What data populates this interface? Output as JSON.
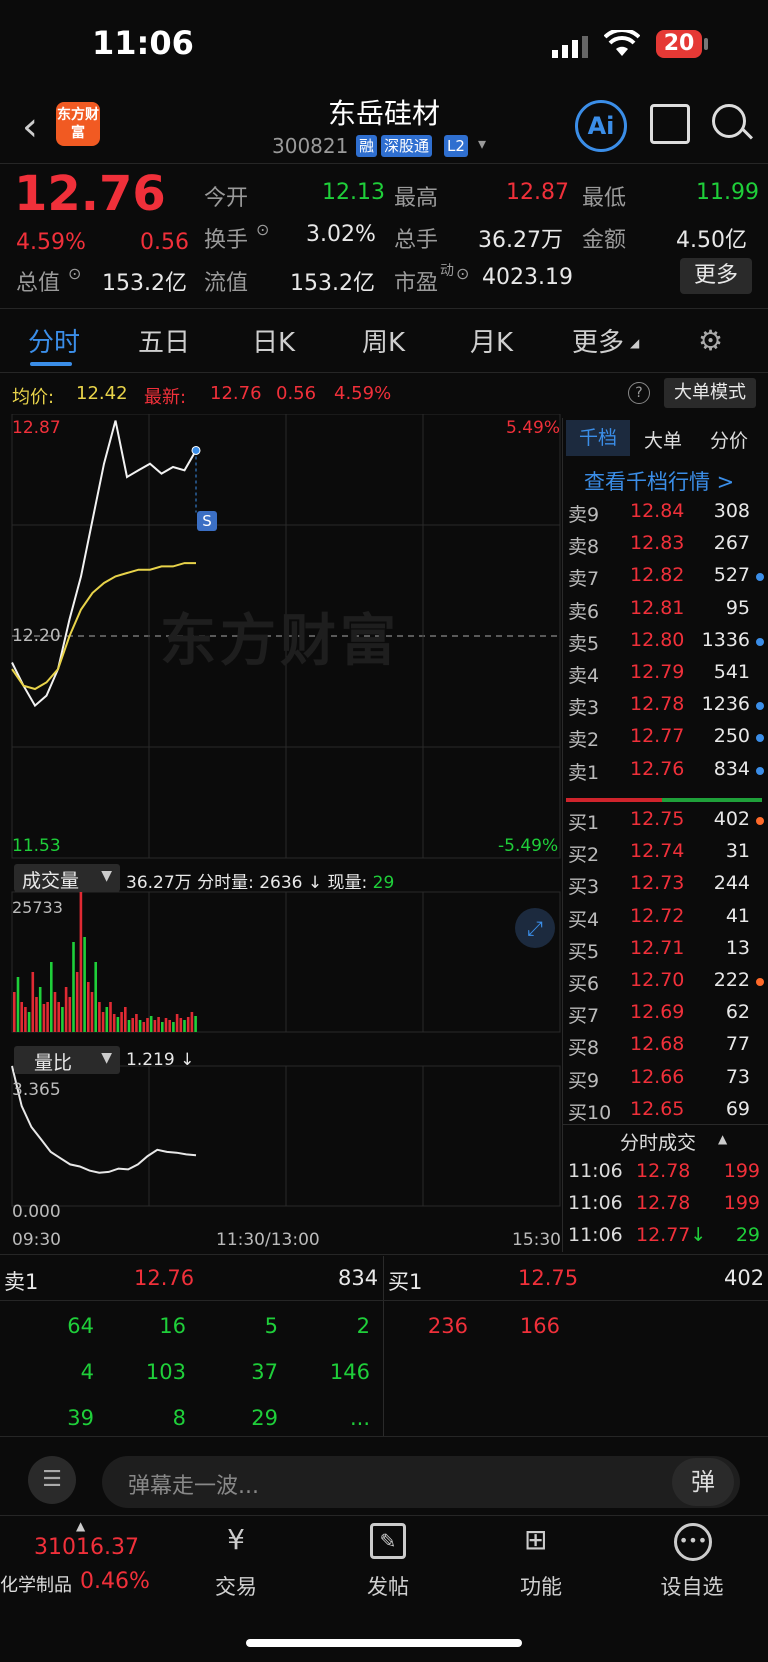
{
  "status": {
    "time": "11:06",
    "battery": "20"
  },
  "header": {
    "stock_name": "东岳硅材",
    "stock_code": "300821",
    "tags": [
      "融",
      "深股通",
      "L2"
    ],
    "logo_text": "东方财富",
    "ai_label": "Ai"
  },
  "quote": {
    "price": "12.76",
    "change_pct": "4.59%",
    "change": "0.56",
    "open_label": "今开",
    "open": "12.13",
    "high_label": "最高",
    "high": "12.87",
    "low_label": "最低",
    "low": "11.99",
    "turnover_label": "换手",
    "turnover": "3.02%",
    "volume_label": "总手",
    "volume": "36.27万",
    "amount_label": "金额",
    "amount": "4.50亿",
    "mktcap_label": "总值",
    "mktcap": "153.2亿",
    "float_label": "流值",
    "float": "153.2亿",
    "pe_label": "市盈",
    "pe_sup": "动",
    "pe": "4023.19",
    "more_label": "更多"
  },
  "tabs": [
    "分时",
    "五日",
    "日K",
    "周K",
    "月K",
    "更多"
  ],
  "info_bar": {
    "avg_label": "均价:",
    "avg": "12.42",
    "latest_label": "最新:",
    "latest": "12.76",
    "change": "0.56",
    "pct": "4.59%",
    "mode_btn": "大单模式"
  },
  "chart": {
    "top_price": "12.87",
    "mid_price": "12.20",
    "bottom_price": "11.53",
    "top_pct": "5.49%",
    "bottom_pct": "-5.49%",
    "watermark": "东方财富",
    "marker": "S",
    "vol_dropdown": "成交量",
    "vol_summary": "36.27万 分时量: 2636 ↓ 现量: ",
    "vol_now": "29",
    "vol_max": "25733",
    "ratio_dropdown": "量比",
    "ratio_value": "1.219 ↓",
    "ratio_max": "3.365",
    "ratio_min": "0.000",
    "time_start": "09:30",
    "time_mid": "11:30/13:00",
    "time_end": "15:30"
  },
  "chart_data": {
    "type": "line",
    "title": "",
    "x": [
      "09:30",
      "11:30/13:00",
      "15:30"
    ],
    "ylim": [
      11.53,
      12.87
    ],
    "series": [
      {
        "name": "最新",
        "values": [
          12.12,
          12.05,
          11.99,
          12.02,
          12.1,
          12.25,
          12.38,
          12.55,
          12.72,
          12.85,
          12.68,
          12.7,
          12.72,
          12.69,
          12.71,
          12.7,
          12.76
        ]
      },
      {
        "name": "均价",
        "values": [
          12.1,
          12.05,
          12.04,
          12.06,
          12.1,
          12.2,
          12.28,
          12.33,
          12.36,
          12.38,
          12.39,
          12.4,
          12.4,
          12.41,
          12.41,
          12.42,
          12.42
        ]
      }
    ],
    "volume_max": 25733,
    "ratio_range": [
      0.0,
      3.365
    ]
  },
  "orderbook": {
    "tabs": [
      "千档",
      "大单",
      "分价"
    ],
    "link": "查看千档行情 >",
    "asks": [
      {
        "label": "卖9",
        "price": "12.84",
        "vol": "308",
        "dot": ""
      },
      {
        "label": "卖8",
        "price": "12.83",
        "vol": "267",
        "dot": ""
      },
      {
        "label": "卖7",
        "price": "12.82",
        "vol": "527",
        "dot": "#3b8ee8"
      },
      {
        "label": "卖6",
        "price": "12.81",
        "vol": "95",
        "dot": ""
      },
      {
        "label": "卖5",
        "price": "12.80",
        "vol": "1336",
        "dot": "#3b8ee8"
      },
      {
        "label": "卖4",
        "price": "12.79",
        "vol": "541",
        "dot": ""
      },
      {
        "label": "卖3",
        "price": "12.78",
        "vol": "1236",
        "dot": "#3b8ee8"
      },
      {
        "label": "卖2",
        "price": "12.77",
        "vol": "250",
        "dot": "#3b8ee8"
      },
      {
        "label": "卖1",
        "price": "12.76",
        "vol": "834",
        "dot": "#3b8ee8"
      }
    ],
    "bids": [
      {
        "label": "买1",
        "price": "12.75",
        "vol": "402",
        "dot": "#ff6a2a"
      },
      {
        "label": "买2",
        "price": "12.74",
        "vol": "31",
        "dot": ""
      },
      {
        "label": "买3",
        "price": "12.73",
        "vol": "244",
        "dot": ""
      },
      {
        "label": "买4",
        "price": "12.72",
        "vol": "41",
        "dot": ""
      },
      {
        "label": "买5",
        "price": "12.71",
        "vol": "13",
        "dot": ""
      },
      {
        "label": "买6",
        "price": "12.70",
        "vol": "222",
        "dot": "#ff6a2a"
      },
      {
        "label": "买7",
        "price": "12.69",
        "vol": "62",
        "dot": ""
      },
      {
        "label": "买8",
        "price": "12.68",
        "vol": "77",
        "dot": ""
      },
      {
        "label": "买9",
        "price": "12.66",
        "vol": "73",
        "dot": ""
      },
      {
        "label": "买10",
        "price": "12.65",
        "vol": "69",
        "dot": ""
      }
    ],
    "trades_title": "分时成交",
    "trades": [
      {
        "time": "11:06",
        "price": "12.78",
        "vol": "199",
        "arrow": ""
      },
      {
        "time": "11:06",
        "price": "12.78",
        "vol": "199",
        "arrow": ""
      },
      {
        "time": "11:06",
        "price": "12.77",
        "vol": "29",
        "arrow": "↓"
      }
    ]
  },
  "queue": {
    "sell_label": "卖1",
    "sell_price": "12.76",
    "sell_vol": "834",
    "buy_label": "买1",
    "buy_price": "12.75",
    "buy_vol": "402",
    "sell_orders": [
      "64",
      "16",
      "5",
      "2",
      "4",
      "103",
      "37",
      "146",
      "39",
      "8",
      "29",
      "..."
    ],
    "buy_orders": [
      "236",
      "166"
    ]
  },
  "comment": {
    "placeholder": "弹幕走一波...",
    "toggle": "弹"
  },
  "bottom_nav": {
    "index_value": "31016.37",
    "index_name": "化学制品",
    "index_pct": "0.46%",
    "items": [
      "交易",
      "发帖",
      "功能",
      "设自选"
    ]
  }
}
